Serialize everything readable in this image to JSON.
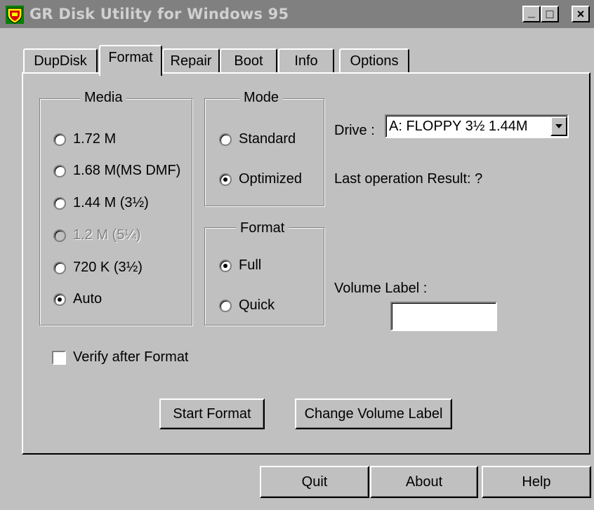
{
  "window": {
    "title": "GR Disk Utility for Windows 95",
    "minimize_label": "_",
    "maximize_label": "□",
    "close_label": "×"
  },
  "tabs": [
    {
      "label": "DupDisk"
    },
    {
      "label": "Format",
      "active": true
    },
    {
      "label": "Repair"
    },
    {
      "label": "Boot"
    },
    {
      "label": "Info"
    },
    {
      "label": "Options"
    }
  ],
  "media": {
    "title": "Media",
    "options": [
      {
        "label": "1.72 M",
        "checked": false,
        "enabled": true
      },
      {
        "label": "1.68 M(MS DMF)",
        "checked": false,
        "enabled": true
      },
      {
        "label": "1.44 M (3½)",
        "checked": false,
        "enabled": true
      },
      {
        "label": "1.2 M (5¼)",
        "checked": false,
        "enabled": false
      },
      {
        "label": "720 K (3½)",
        "checked": false,
        "enabled": true
      },
      {
        "label": "Auto",
        "checked": true,
        "enabled": true
      }
    ]
  },
  "mode": {
    "title": "Mode",
    "options": [
      {
        "label": "Standard",
        "checked": false
      },
      {
        "label": "Optimized",
        "checked": true
      }
    ]
  },
  "format_type": {
    "title": "Format",
    "options": [
      {
        "label": "Full",
        "checked": true
      },
      {
        "label": "Quick",
        "checked": false
      }
    ]
  },
  "drive": {
    "label": "Drive :",
    "value": "A:  FLOPPY 3½ 1.44M"
  },
  "last_result": "Last operation Result: ?",
  "volume_label": {
    "label": "Volume Label :",
    "value": ""
  },
  "verify": {
    "label": "Verify after Format",
    "checked": false
  },
  "buttons": {
    "start_format": "Start Format",
    "change_volume_label": "Change Volume Label",
    "quit": "Quit",
    "about": "About",
    "help": "Help"
  }
}
